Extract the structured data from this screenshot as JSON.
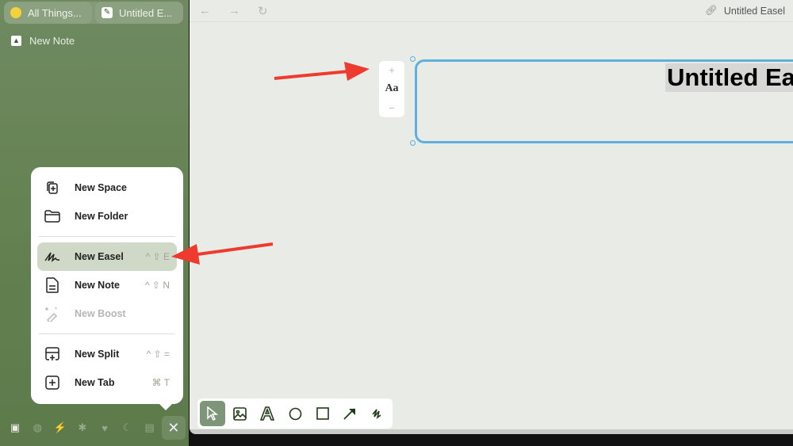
{
  "sidebar": {
    "tabs": [
      {
        "label": "All Things...",
        "icon": "lightbulb-icon"
      },
      {
        "label": "Untitled E...",
        "icon": "easel-icon"
      }
    ],
    "note_item": "New Note",
    "bottom_icons": [
      "gift-box-icon",
      "planet-icon",
      "bolt-icon",
      "asterisk-icon",
      "heart-icon",
      "moon-icon",
      "gift-icon",
      "close-icon"
    ]
  },
  "menu": {
    "items": [
      {
        "label": "New Space",
        "shortcut": ""
      },
      {
        "label": "New Folder",
        "shortcut": ""
      },
      {
        "label": "New Easel",
        "shortcut": "^ ⇧ E"
      },
      {
        "label": "New Note",
        "shortcut": "^ ⇧ N"
      },
      {
        "label": "New Boost",
        "shortcut": ""
      },
      {
        "label": "New Split",
        "shortcut": "^ ⇧ ="
      },
      {
        "label": "New Tab",
        "shortcut": "⌘ T"
      }
    ]
  },
  "main": {
    "title": "Untitled Easel",
    "canvas_title": "Untitled Ea",
    "font_control": {
      "increase": "+",
      "label": "Aa",
      "decrease": "−"
    }
  },
  "colors": {
    "accent": "#5fb0dc",
    "sidebar": "#6a8659",
    "arrow": "#ee3b2f"
  }
}
